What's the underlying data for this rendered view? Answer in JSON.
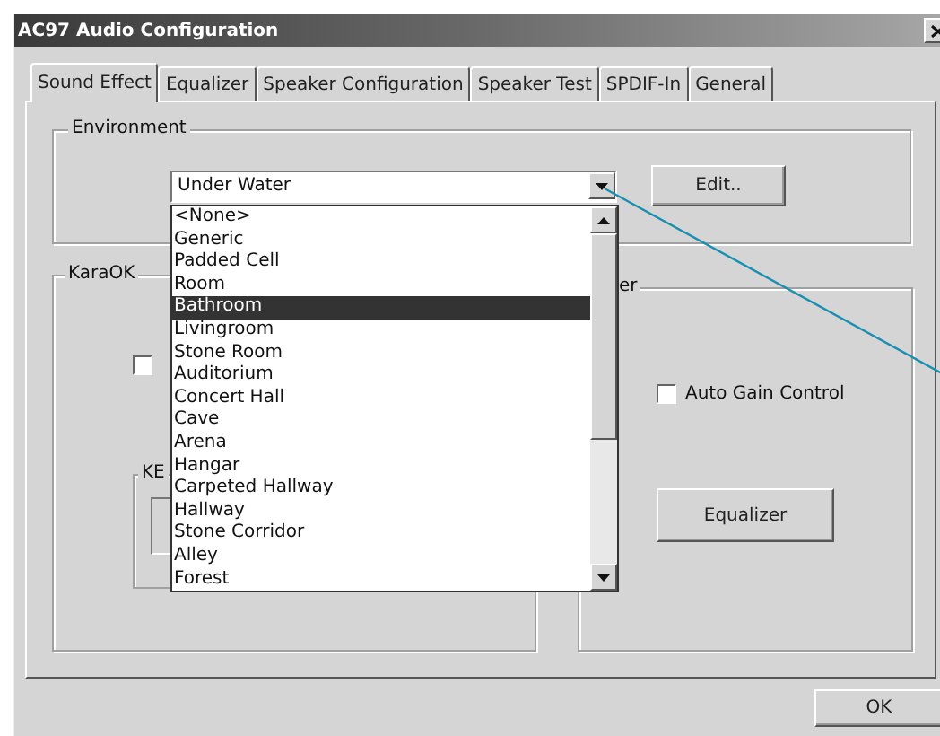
{
  "window": {
    "title": "AC97 Audio Configuration"
  },
  "tabs": [
    {
      "label": "Sound Effect",
      "selected": true
    },
    {
      "label": "Equalizer",
      "selected": false
    },
    {
      "label": "Speaker Configuration",
      "selected": false
    },
    {
      "label": "Speaker Test",
      "selected": false
    },
    {
      "label": "SPDIF-In",
      "selected": false
    },
    {
      "label": "General",
      "selected": false
    }
  ],
  "environment": {
    "label": "Environment",
    "combo_value": "Under Water",
    "edit_button": "Edit..",
    "dropdown": {
      "items": [
        {
          "label": "<None>",
          "selected": false
        },
        {
          "label": "Generic",
          "selected": false
        },
        {
          "label": "Padded Cell",
          "selected": false
        },
        {
          "label": "Room",
          "selected": false
        },
        {
          "label": "Bathroom",
          "selected": true
        },
        {
          "label": "Livingroom",
          "selected": false
        },
        {
          "label": "Stone Room",
          "selected": false
        },
        {
          "label": "Auditorium",
          "selected": false
        },
        {
          "label": "Concert Hall",
          "selected": false
        },
        {
          "label": "Cave",
          "selected": false
        },
        {
          "label": "Arena",
          "selected": false
        },
        {
          "label": "Hangar",
          "selected": false
        },
        {
          "label": "Carpeted Hallway",
          "selected": false
        },
        {
          "label": "Hallway",
          "selected": false
        },
        {
          "label": "Stone Corridor",
          "selected": false
        },
        {
          "label": "Alley",
          "selected": false
        },
        {
          "label": "Forest",
          "selected": false
        }
      ]
    }
  },
  "karaok": {
    "label": "KaraOK",
    "checkbox": {
      "checked": false
    },
    "key_group_label": "KE"
  },
  "right_group": {
    "label": "er",
    "auto_gain_control": {
      "label": "Auto Gain Control",
      "checked": false
    },
    "equalizer_button": "Equalizer"
  },
  "buttons": [
    "OK"
  ]
}
